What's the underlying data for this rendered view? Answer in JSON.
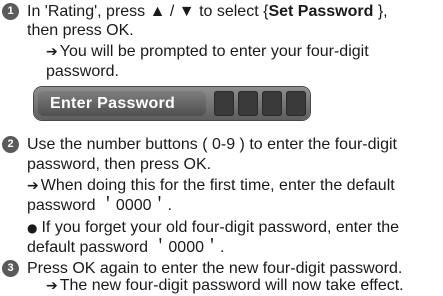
{
  "steps": [
    {
      "number": "1",
      "line1_pre": "In 'Rating', press ▲ / ▼ to select {",
      "line1_bold": "Set Password",
      "line1_post": " },",
      "line2": "then press OK.",
      "line3_arrow": "➔",
      "line3": "You will be prompted to enter your four-digit",
      "line4": "password."
    },
    {
      "number": "2",
      "line1": "Use the number buttons ( 0-9 ) to enter the four-digit",
      "line2": "password, then press OK.",
      "line3_arrow": "➔",
      "line3": "When doing this for the first time, enter the default",
      "line4": "password ＇0000＇.",
      "line5_bullet": "●",
      "line5": "If you forget your old four-digit password, enter the",
      "line6": "default password ＇0000＇."
    },
    {
      "number": "3",
      "line1": "Press OK again to enter the new four-digit password.",
      "line2_arrow": "➔",
      "line2": "The new four-digit password will now take effect."
    }
  ],
  "password_box": {
    "label": "Enter Password",
    "digit_count": 4
  },
  "colors": {
    "number_badge": "#5a5a5a",
    "password_box": "#6e6e6e",
    "digit_slot": "#3a3a3a"
  }
}
